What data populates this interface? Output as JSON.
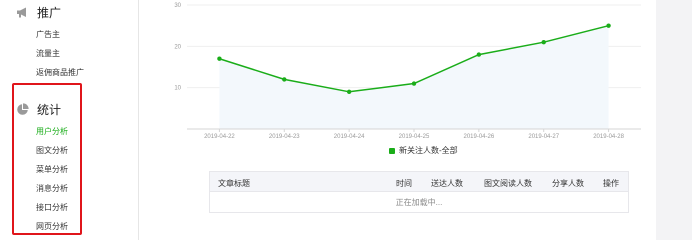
{
  "sidebar": {
    "promote": {
      "title": "推广",
      "icon": "megaphone-icon",
      "items": [
        {
          "label": "广告主"
        },
        {
          "label": "流量主"
        },
        {
          "label": "返佣商品推广"
        }
      ]
    },
    "stats": {
      "title": "统计",
      "icon": "pie-chart-icon",
      "items": [
        {
          "label": "用户分析",
          "active": true
        },
        {
          "label": "图文分析"
        },
        {
          "label": "菜单分析"
        },
        {
          "label": "消息分析"
        },
        {
          "label": "接口分析"
        },
        {
          "label": "网页分析"
        }
      ]
    },
    "accent_color": "#1aad19",
    "highlight_color": "#e0151b"
  },
  "chart_data": {
    "type": "line",
    "x": [
      "2019-04-22",
      "2019-04-23",
      "2019-04-24",
      "2019-04-25",
      "2019-04-26",
      "2019-04-27",
      "2019-04-28"
    ],
    "series": [
      {
        "name": "新关注人数-全部",
        "values": [
          17,
          12,
          9,
          11,
          18,
          21,
          25
        ],
        "color": "#1aad19"
      }
    ],
    "yticks": [
      "10",
      "20",
      "30"
    ],
    "ylim": [
      0,
      30
    ],
    "legend_position": "bottom"
  },
  "table": {
    "headers": {
      "title": "文章标题",
      "time": "时间",
      "delivered": "送达人数",
      "reads": "图文阅读人数",
      "shares": "分享人数",
      "actions": "操作"
    },
    "loading_text": "正在加载中..."
  }
}
